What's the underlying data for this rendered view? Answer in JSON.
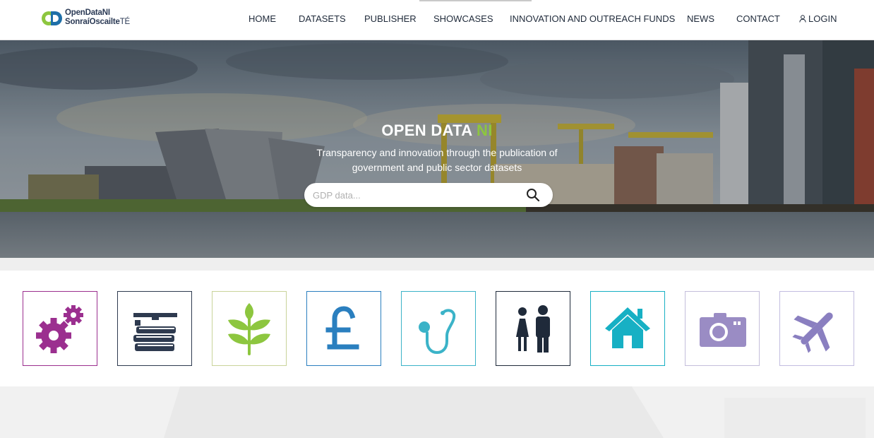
{
  "logo": {
    "line1": "OpenDataNI",
    "line2": "SonraíOscailte",
    "line2_suffix": "TÉ"
  },
  "nav": {
    "items": [
      {
        "label": "HOME"
      },
      {
        "label": "DATASETS"
      },
      {
        "label": "PUBLISHER"
      },
      {
        "label": "SHOWCASES"
      },
      {
        "label": "INNOVATION AND OUTREACH FUNDS"
      },
      {
        "label": "NEWS"
      },
      {
        "label": "CONTACT"
      },
      {
        "label": "LOGIN"
      }
    ]
  },
  "hero": {
    "title_main": "OPEN DATA",
    "title_accent": "NI",
    "subtitle": "Transparency and innovation through the publication of government and public sector datasets",
    "search_placeholder": "GDP data..."
  },
  "categories": [
    {
      "icon": "gears-icon",
      "color": "#9b2f8f"
    },
    {
      "icon": "books-graduation-icon",
      "color": "#2e3a4f"
    },
    {
      "icon": "plant-icon",
      "color": "#8dc63f"
    },
    {
      "icon": "pound-icon",
      "color": "#2a7fbf"
    },
    {
      "icon": "stethoscope-icon",
      "color": "#3bb3c8"
    },
    {
      "icon": "people-icon",
      "color": "#1f2a3a"
    },
    {
      "icon": "house-icon",
      "color": "#17b0c4"
    },
    {
      "icon": "camera-icon",
      "color": "#9a8cc4"
    },
    {
      "icon": "airplane-icon",
      "color": "#8a7fc0"
    }
  ],
  "colors": {
    "accent_green": "#8dc63f",
    "nav_text": "#1f2a3a"
  }
}
